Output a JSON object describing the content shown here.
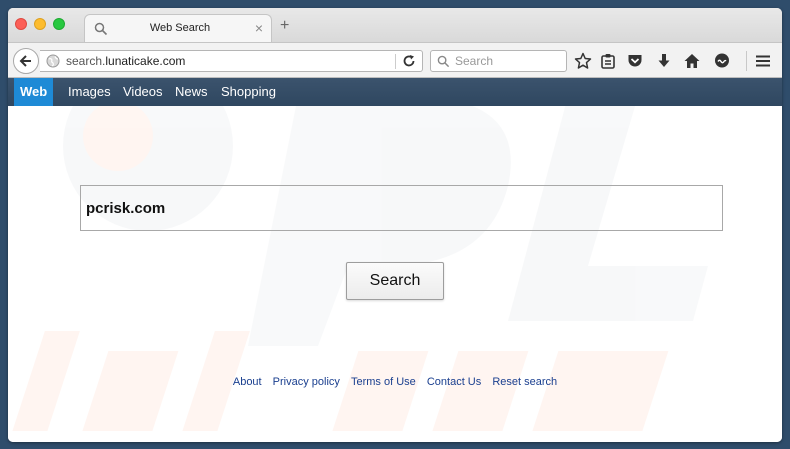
{
  "tab": {
    "title": "Web Search",
    "close_glyph": "×",
    "new_tab_glyph": "+"
  },
  "addressbar": {
    "url_prefix": "search.",
    "url_host": "lunaticake.com"
  },
  "searchbar": {
    "placeholder": "Search"
  },
  "sitenav": {
    "items": [
      {
        "label": "Web",
        "active": true
      },
      {
        "label": "Images"
      },
      {
        "label": "Videos"
      },
      {
        "label": "News"
      },
      {
        "label": "Shopping"
      }
    ]
  },
  "main": {
    "query_value": "pcrisk.com",
    "search_button_label": "Search"
  },
  "footer": {
    "links": [
      "About",
      "Privacy policy",
      "Terms of Use",
      "Contact Us",
      "Reset search"
    ]
  },
  "toolbar_icons": [
    "bookmark-star-icon",
    "reading-list-icon",
    "pocket-icon",
    "download-icon",
    "home-icon",
    "chat-icon",
    "hamburger-menu-icon"
  ],
  "colors": {
    "desktop": "#2f4d6b",
    "nav_active": "#1e8ad6",
    "link": "#1a3f8f"
  }
}
